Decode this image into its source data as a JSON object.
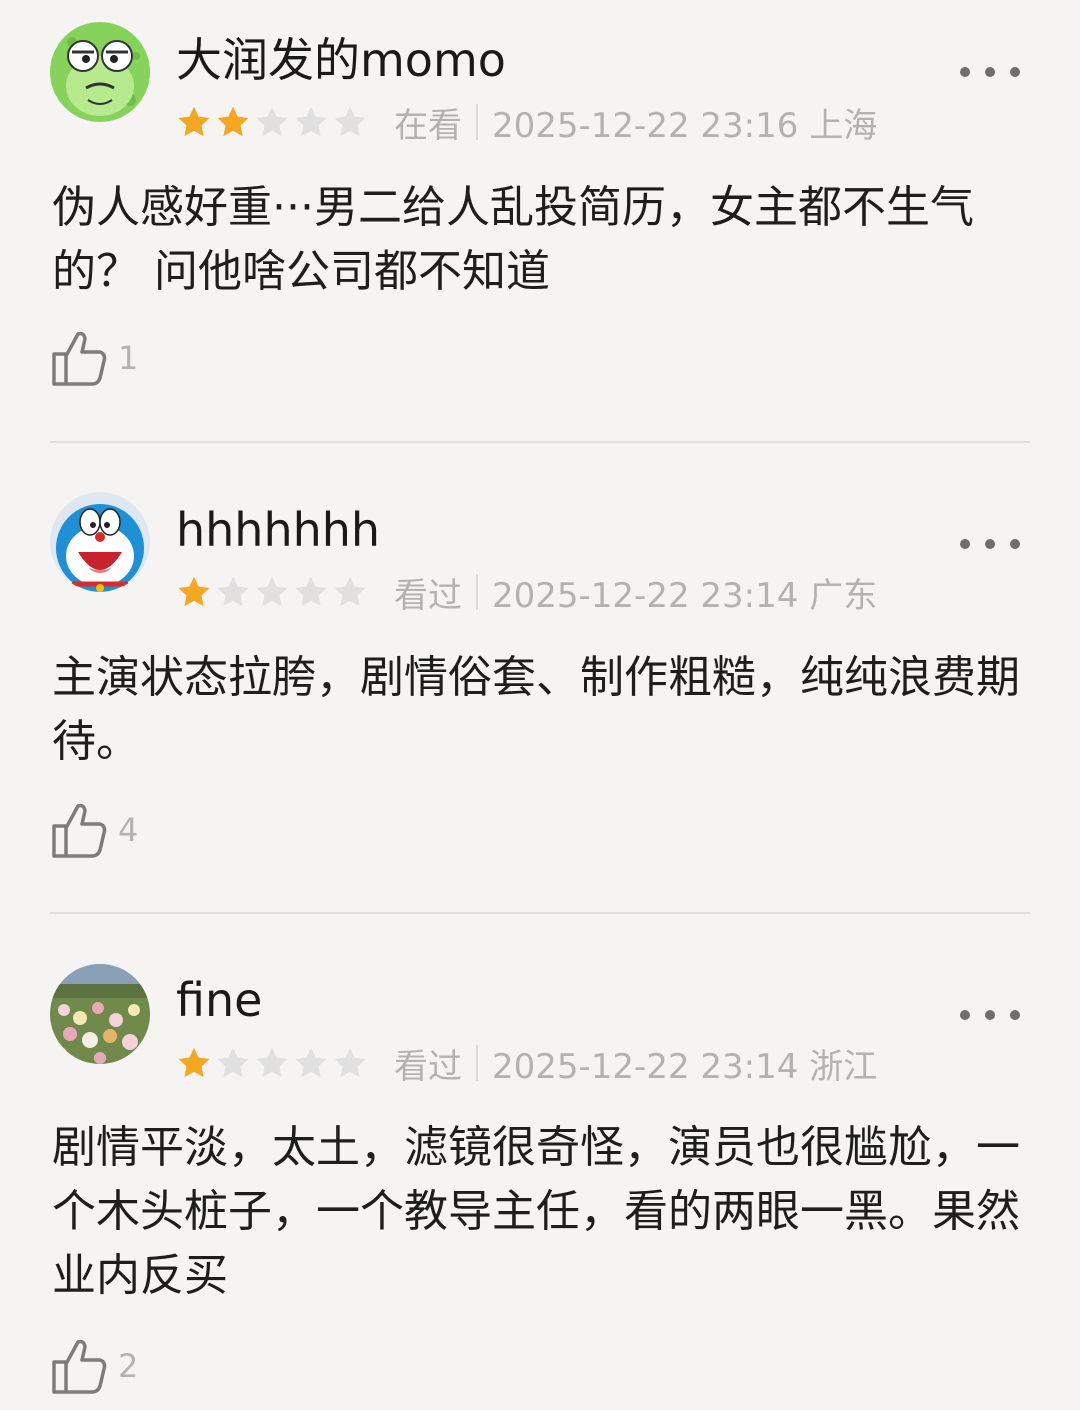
{
  "reviews": [
    {
      "username": "大润发的momo",
      "rating": 2,
      "max_rating": 5,
      "status": "在看",
      "time": "2025-12-22 23:16 上海",
      "content": "伪人感好重···男二给人乱投简历，女主都不生气的？ 问他啥公司都不知道",
      "likes": "1",
      "avatar_icon": "frog-avatar-icon"
    },
    {
      "username": "hhhhhhh",
      "rating": 1,
      "max_rating": 5,
      "status": "看过",
      "time": "2025-12-22 23:14 广东",
      "content": "主演状态拉胯，剧情俗套、制作粗糙，纯纯浪费期待。",
      "likes": "4",
      "avatar_icon": "doraemon-avatar-icon"
    },
    {
      "username": "fine",
      "rating": 1,
      "max_rating": 5,
      "status": "看过",
      "time": "2025-12-22 23:14 浙江",
      "content": "剧情平淡，太土，滤镜很奇怪，演员也很尴尬，一个木头桩子，一个教导主任，看的两眼一黑。果然业内反买",
      "likes": "2",
      "avatar_icon": "flower-field-avatar-icon"
    }
  ],
  "colors": {
    "background": "#f5f4f3",
    "star_active": "#f5a623",
    "star_inactive": "#e0e0e0",
    "muted_text": "#b2b2b2",
    "main_text": "#1e1e1e"
  },
  "icons": {
    "more": "more-dots-icon",
    "like": "thumbs-up-icon",
    "star": "star-icon"
  }
}
